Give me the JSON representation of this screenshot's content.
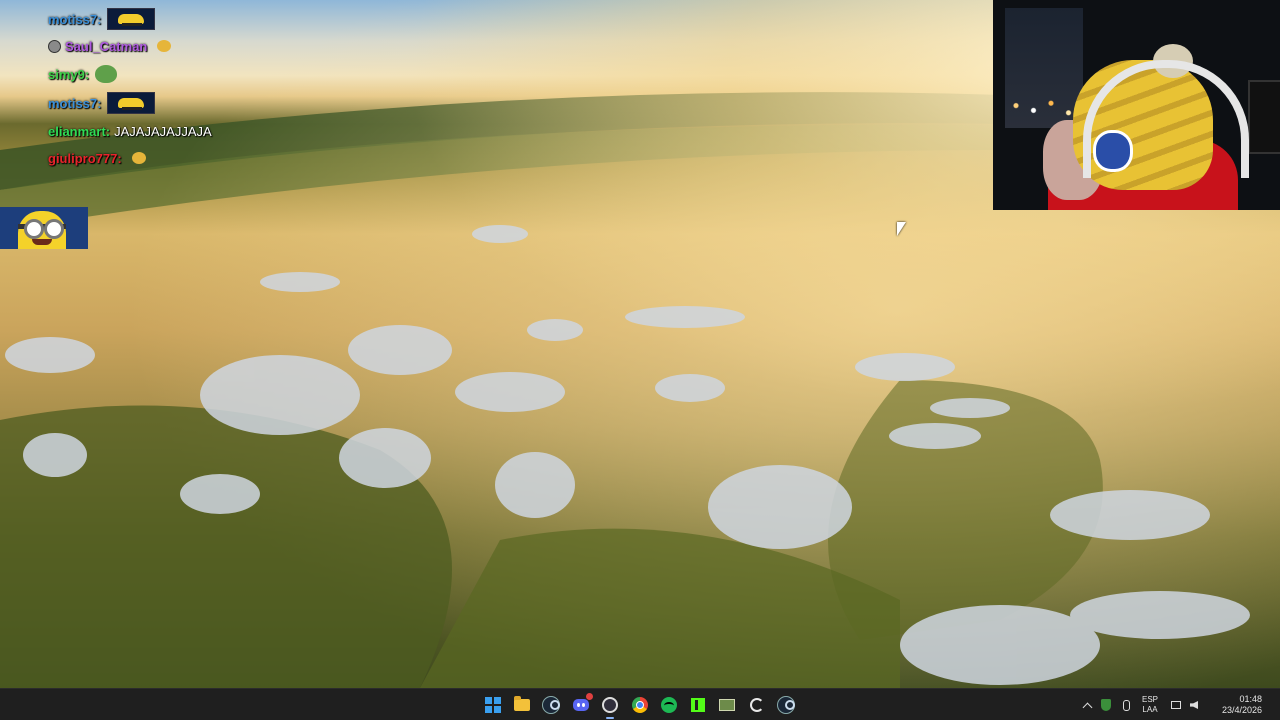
{
  "chat": {
    "messages": [
      {
        "user": "motiss7:",
        "user_color": "#3a8fd8",
        "text": "",
        "emote": "car-emote"
      },
      {
        "user": "Saul_Catman",
        "user_color": "#b05be0",
        "text": "",
        "emote": "duck-emote",
        "badge": "gray-badge"
      },
      {
        "user": "simy9:",
        "user_color": "#3fd24a",
        "text": "",
        "emote": "pepe-emote"
      },
      {
        "user": "motiss7:",
        "user_color": "#3a8fd8",
        "text": "",
        "emote": "car-emote"
      },
      {
        "user": "elianmart:",
        "user_color": "#2fdc55",
        "text": "JAJAJAJAJJAJA",
        "emote": ""
      },
      {
        "user": "giulipro777:",
        "user_color": "#e8242b",
        "text": "",
        "emote": "duck-emote"
      }
    ],
    "overlay_emote": "minion-emote"
  },
  "webcam": {
    "label": "streamer-webcam"
  },
  "taskbar": {
    "apps": [
      {
        "name": "start",
        "icon": "windows-start-icon"
      },
      {
        "name": "file-explorer",
        "icon": "folder-icon"
      },
      {
        "name": "steam",
        "icon": "steam-icon"
      },
      {
        "name": "discord",
        "icon": "discord-icon",
        "notification": true
      },
      {
        "name": "obs",
        "icon": "obs-icon",
        "active": true
      },
      {
        "name": "chrome",
        "icon": "chrome-icon"
      },
      {
        "name": "spotify",
        "icon": "spotify-icon"
      },
      {
        "name": "kick",
        "icon": "kick-icon"
      },
      {
        "name": "photos",
        "icon": "photo-icon"
      },
      {
        "name": "refresh-app",
        "icon": "refresh-icon"
      },
      {
        "name": "steam-2",
        "icon": "steam-icon"
      }
    ],
    "tray": {
      "language_line1": "ESP",
      "language_line2": "LAA",
      "time": "01:48",
      "date": "23/4/2026"
    }
  },
  "colors": {
    "taskbar_bg": "#1f1f1f",
    "accent": "#8ab4f8"
  }
}
